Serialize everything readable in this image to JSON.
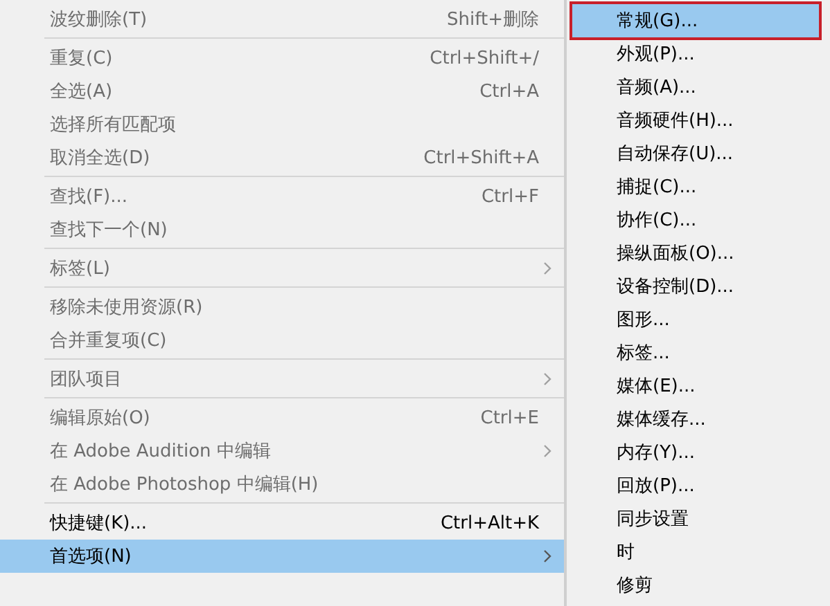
{
  "menu": {
    "items": [
      {
        "kind": "item",
        "label": "波纹删除(T)",
        "shortcut": "Shift+删除",
        "disabled": true,
        "submenu": false,
        "selected": false
      },
      {
        "kind": "separator"
      },
      {
        "kind": "item",
        "label": "重复(C)",
        "shortcut": "Ctrl+Shift+/",
        "disabled": true,
        "submenu": false,
        "selected": false
      },
      {
        "kind": "item",
        "label": "全选(A)",
        "shortcut": "Ctrl+A",
        "disabled": true,
        "submenu": false,
        "selected": false
      },
      {
        "kind": "item",
        "label": "选择所有匹配项",
        "disabled": true,
        "submenu": false,
        "selected": false
      },
      {
        "kind": "item",
        "label": "取消全选(D)",
        "shortcut": "Ctrl+Shift+A",
        "disabled": true,
        "submenu": false,
        "selected": false
      },
      {
        "kind": "separator"
      },
      {
        "kind": "item",
        "label": "查找(F)...",
        "shortcut": "Ctrl+F",
        "disabled": true,
        "submenu": false,
        "selected": false
      },
      {
        "kind": "item",
        "label": "查找下一个(N)",
        "disabled": true,
        "submenu": false,
        "selected": false
      },
      {
        "kind": "separator"
      },
      {
        "kind": "item",
        "label": "标签(L)",
        "disabled": true,
        "submenu": true,
        "selected": false
      },
      {
        "kind": "separator"
      },
      {
        "kind": "item",
        "label": "移除未使用资源(R)",
        "disabled": true,
        "submenu": false,
        "selected": false
      },
      {
        "kind": "item",
        "label": "合并重复项(C)",
        "disabled": true,
        "submenu": false,
        "selected": false
      },
      {
        "kind": "separator"
      },
      {
        "kind": "item",
        "label": "团队项目",
        "disabled": true,
        "submenu": true,
        "selected": false
      },
      {
        "kind": "separator"
      },
      {
        "kind": "item",
        "label": "编辑原始(O)",
        "shortcut": "Ctrl+E",
        "disabled": true,
        "submenu": false,
        "selected": false
      },
      {
        "kind": "item",
        "label": "在 Adobe Audition 中编辑",
        "disabled": true,
        "submenu": true,
        "selected": false
      },
      {
        "kind": "item",
        "label": "在 Adobe Photoshop 中编辑(H)",
        "disabled": true,
        "submenu": false,
        "selected": false
      },
      {
        "kind": "separator"
      },
      {
        "kind": "item",
        "label": "快捷键(K)...",
        "shortcut": "Ctrl+Alt+K",
        "disabled": false,
        "submenu": false,
        "selected": false
      },
      {
        "kind": "item",
        "label": "首选项(N)",
        "disabled": false,
        "submenu": true,
        "selected": true
      }
    ]
  },
  "submenu": {
    "items": [
      {
        "label": "常规(G)...",
        "selected": true,
        "outlined": true
      },
      {
        "label": "外观(P)...",
        "selected": false,
        "outlined": false
      },
      {
        "label": "音频(A)...",
        "selected": false,
        "outlined": false
      },
      {
        "label": "音频硬件(H)...",
        "selected": false,
        "outlined": false
      },
      {
        "label": "自动保存(U)...",
        "selected": false,
        "outlined": false
      },
      {
        "label": "捕捉(C)...",
        "selected": false,
        "outlined": false
      },
      {
        "label": "协作(C)...",
        "selected": false,
        "outlined": false
      },
      {
        "label": "操纵面板(O)...",
        "selected": false,
        "outlined": false
      },
      {
        "label": "设备控制(D)...",
        "selected": false,
        "outlined": false
      },
      {
        "label": "图形...",
        "selected": false,
        "outlined": false
      },
      {
        "label": "标签...",
        "selected": false,
        "outlined": false
      },
      {
        "label": "媒体(E)...",
        "selected": false,
        "outlined": false
      },
      {
        "label": "媒体缓存...",
        "selected": false,
        "outlined": false
      },
      {
        "label": "内存(Y)...",
        "selected": false,
        "outlined": false
      },
      {
        "label": "回放(P)...",
        "selected": false,
        "outlined": false
      },
      {
        "label": "同步设置",
        "selected": false,
        "outlined": false
      },
      {
        "label": "时",
        "selected": false,
        "outlined": false
      },
      {
        "label": "修剪",
        "selected": false,
        "outlined": false
      }
    ]
  }
}
